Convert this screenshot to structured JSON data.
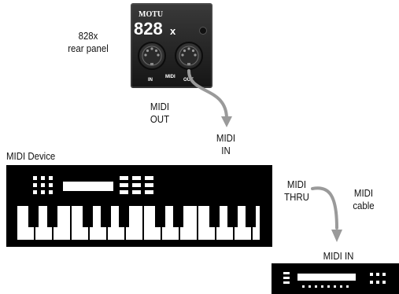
{
  "interface": {
    "brand": "MOTU",
    "model_number": "828",
    "model_suffix": "x",
    "caption_line1": "828x",
    "caption_line2": "rear panel",
    "port_in": "IN",
    "port_midi": "MIDI",
    "port_out": "OUT"
  },
  "labels": {
    "midi_out_line1": "MIDI",
    "midi_out_line2": "OUT",
    "midi_in_top_line1": "MIDI",
    "midi_in_top_line2": "IN",
    "midi_device": "MIDI Device",
    "midi_thru_line1": "MIDI",
    "midi_thru_line2": "THRU",
    "midi_cable_line1": "MIDI",
    "midi_cable_line2": "cable",
    "midi_in_bottom": "MIDI IN"
  },
  "colors": {
    "panel": "#222222",
    "cable": "#9a9a9a",
    "device": "#000000"
  }
}
